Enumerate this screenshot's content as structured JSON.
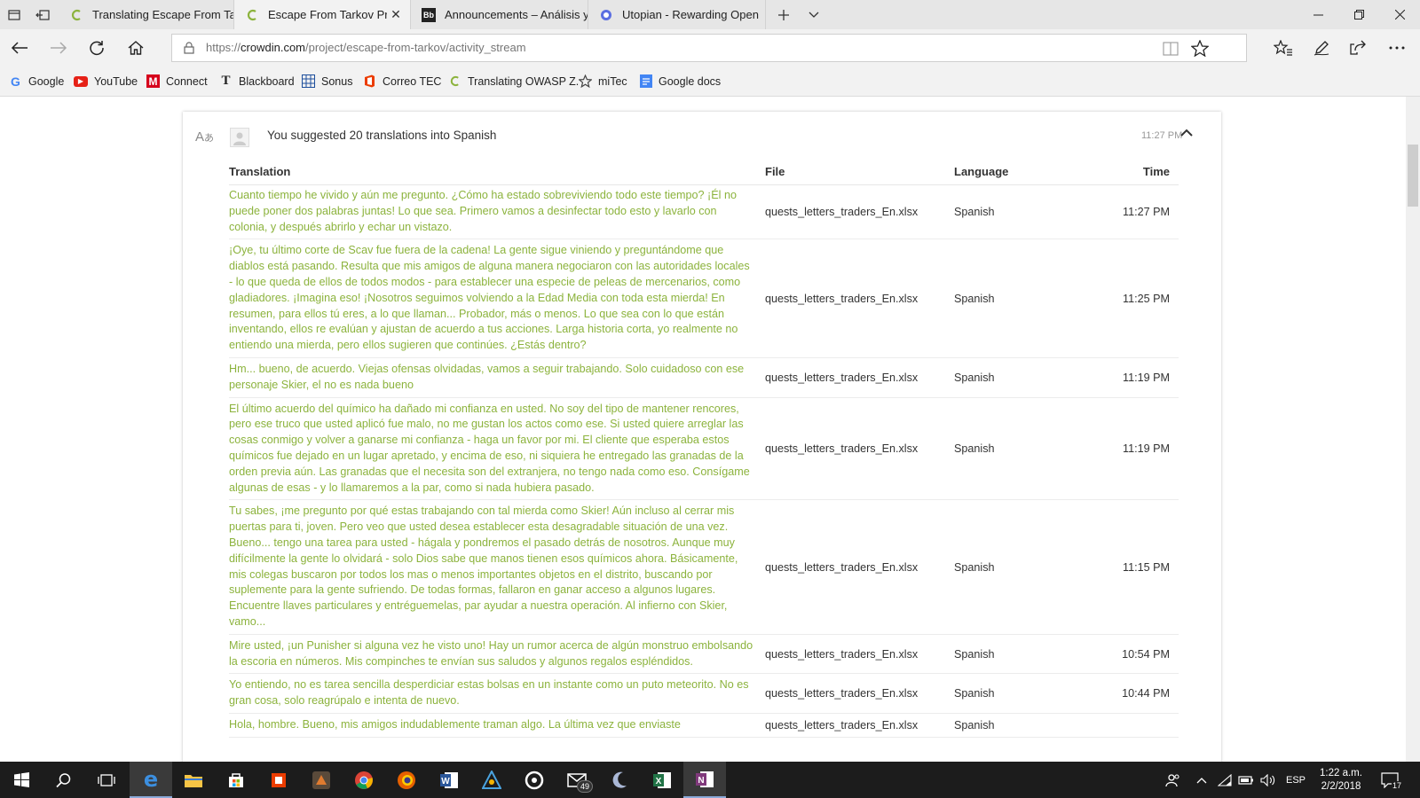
{
  "tabs": [
    {
      "title": "Translating Escape From Tar",
      "active": false,
      "icon": "crowdin-icon"
    },
    {
      "title": "Escape From Tarkov Prc",
      "active": true,
      "icon": "crowdin-icon"
    },
    {
      "title": "Announcements – Análisis y",
      "active": false,
      "icon": "blackboard-icon"
    },
    {
      "title": "Utopian - Rewarding Open",
      "active": false,
      "icon": "utopian-icon"
    }
  ],
  "address": {
    "prefix": "https://",
    "domain": "crowdin.com",
    "path": "/project/escape-from-tarkov/activity_stream"
  },
  "bookmarks": [
    {
      "label": "Google",
      "icon": "google-icon",
      "color": "#4285f4"
    },
    {
      "label": "YouTube",
      "icon": "youtube-icon",
      "color": "#e62117"
    },
    {
      "label": "Connect",
      "icon": "mcgraw-icon",
      "color": "#d6001c"
    },
    {
      "label": "Blackboard",
      "icon": "blackboard-icon",
      "color": "#333333"
    },
    {
      "label": "Sonus",
      "icon": "sonus-icon",
      "color": "#1e4f9c"
    },
    {
      "label": "Correo TEC",
      "icon": "office-icon",
      "color": "#eb3c00"
    },
    {
      "label": "Translating OWASP Z.",
      "icon": "crowdin-icon",
      "color": "#8cb33d"
    },
    {
      "label": "miTec",
      "icon": "star-icon",
      "color": "#444444"
    },
    {
      "label": "Google docs",
      "icon": "docs-icon",
      "color": "#4285f4"
    }
  ],
  "activity": {
    "summary": "You suggested 20 translations into Spanish",
    "time": "11:27 PM"
  },
  "table": {
    "headers": {
      "translation": "Translation",
      "file": "File",
      "language": "Language",
      "time": "Time"
    },
    "rows": [
      {
        "translation": "Cuanto tiempo he vivido y aún me pregunto. ¿Cómo ha estado sobreviviendo todo este tiempo? ¡Él no puede poner dos palabras juntas! Lo que sea. Primero vamos a desinfectar todo esto y lavarlo con colonia, y después abrirlo y echar un vistazo.",
        "file": "quests_letters_traders_En.xlsx",
        "language": "Spanish",
        "time": "11:27 PM"
      },
      {
        "translation": "¡Oye, tu último corte de Scav fue fuera de la cadena! La gente sigue viniendo y preguntándome que diablos está pasando. Resulta que mis amigos de alguna manera negociaron con las autoridades locales - lo que queda de ellos de todos modos - para establecer una especie de peleas de mercenarios, como gladiadores. ¡Imagina eso! ¡Nosotros seguimos volviendo a la Edad Media con toda esta mierda! En resumen, para ellos tú eres, a lo que llaman... Probador, más o menos. Lo que sea con lo que están inventando, ellos re evalúan y ajustan de acuerdo a tus acciones. Larga historia corta, yo realmente no entiendo una mierda, pero ellos sugieren que continúes. ¿Estás dentro?",
        "file": "quests_letters_traders_En.xlsx",
        "language": "Spanish",
        "time": "11:25 PM"
      },
      {
        "translation": "Hm... bueno, de acuerdo. Viejas ofensas olvidadas, vamos a seguir trabajando. Solo cuidadoso con ese personaje Skier, el no es nada bueno",
        "file": "quests_letters_traders_En.xlsx",
        "language": "Spanish",
        "time": "11:19 PM"
      },
      {
        "translation": "El último acuerdo del químico ha dañado mi confianza en usted. No soy del tipo de mantener rencores, pero ese truco que usted aplicó fue malo, no me gustan los actos como ese. Si usted quiere arreglar las cosas conmigo y volver a ganarse mi confianza - haga un favor por mi. El cliente que esperaba estos químicos fue dejado en un lugar apretado, y encima de eso, ni siquiera he entregado las granadas de la orden previa aún. Las granadas que el necesita son del extranjera, no tengo nada como eso. Consígame algunas de esas - y lo llamaremos a la par, como si nada hubiera pasado.",
        "file": "quests_letters_traders_En.xlsx",
        "language": "Spanish",
        "time": "11:19 PM"
      },
      {
        "translation": "Tu sabes, ¡me pregunto por qué estas trabajando con tal mierda como Skier! Aún incluso al cerrar mis puertas para ti, joven. Pero veo que usted desea establecer esta desagradable situación de una vez. Bueno... tengo una tarea para usted - hágala y pondremos el pasado detrás de nosotros. Aunque muy difícilmente la gente lo olvidará - solo Dios sabe que manos tienen esos químicos ahora. Básicamente, mis colegas buscaron por todos los mas o menos importantes objetos en el distrito, buscando por suplemente para la gente sufriendo. De todas formas, fallaron en ganar acceso a algunos lugares. Encuentre llaves particulares y entréguemelas, par ayudar a nuestra operación. Al infierno con Skier, vamo...",
        "file": "quests_letters_traders_En.xlsx",
        "language": "Spanish",
        "time": "11:15 PM"
      },
      {
        "translation": "Mire usted, ¡un Punisher si alguna vez he visto uno! Hay un rumor acerca de algún monstruo embolsando la escoria en números. Mis compinches te envían sus saludos y algunos regalos espléndidos.",
        "file": "quests_letters_traders_En.xlsx",
        "language": "Spanish",
        "time": "10:54 PM"
      },
      {
        "translation": "Yo entiendo, no es tarea sencilla desperdiciar estas bolsas en un instante como un puto meteorito. No es gran cosa, solo reagrúpalo e intenta de nuevo.",
        "file": "quests_letters_traders_En.xlsx",
        "language": "Spanish",
        "time": "10:44 PM"
      },
      {
        "translation": "Hola, hombre. Bueno, mis amigos indudablemente traman algo. La última vez que enviaste",
        "file": "quests_letters_traders_En.xlsx",
        "language": "Spanish",
        "time": ""
      }
    ]
  },
  "taskbar": {
    "mail_badge": "49",
    "language": "ESP",
    "clock_time": "1:22 a.m.",
    "clock_date": "2/2/2018",
    "notifications": "17"
  },
  "colors": {
    "translation_text": "#8cb33d",
    "accent": "#0078d7"
  }
}
